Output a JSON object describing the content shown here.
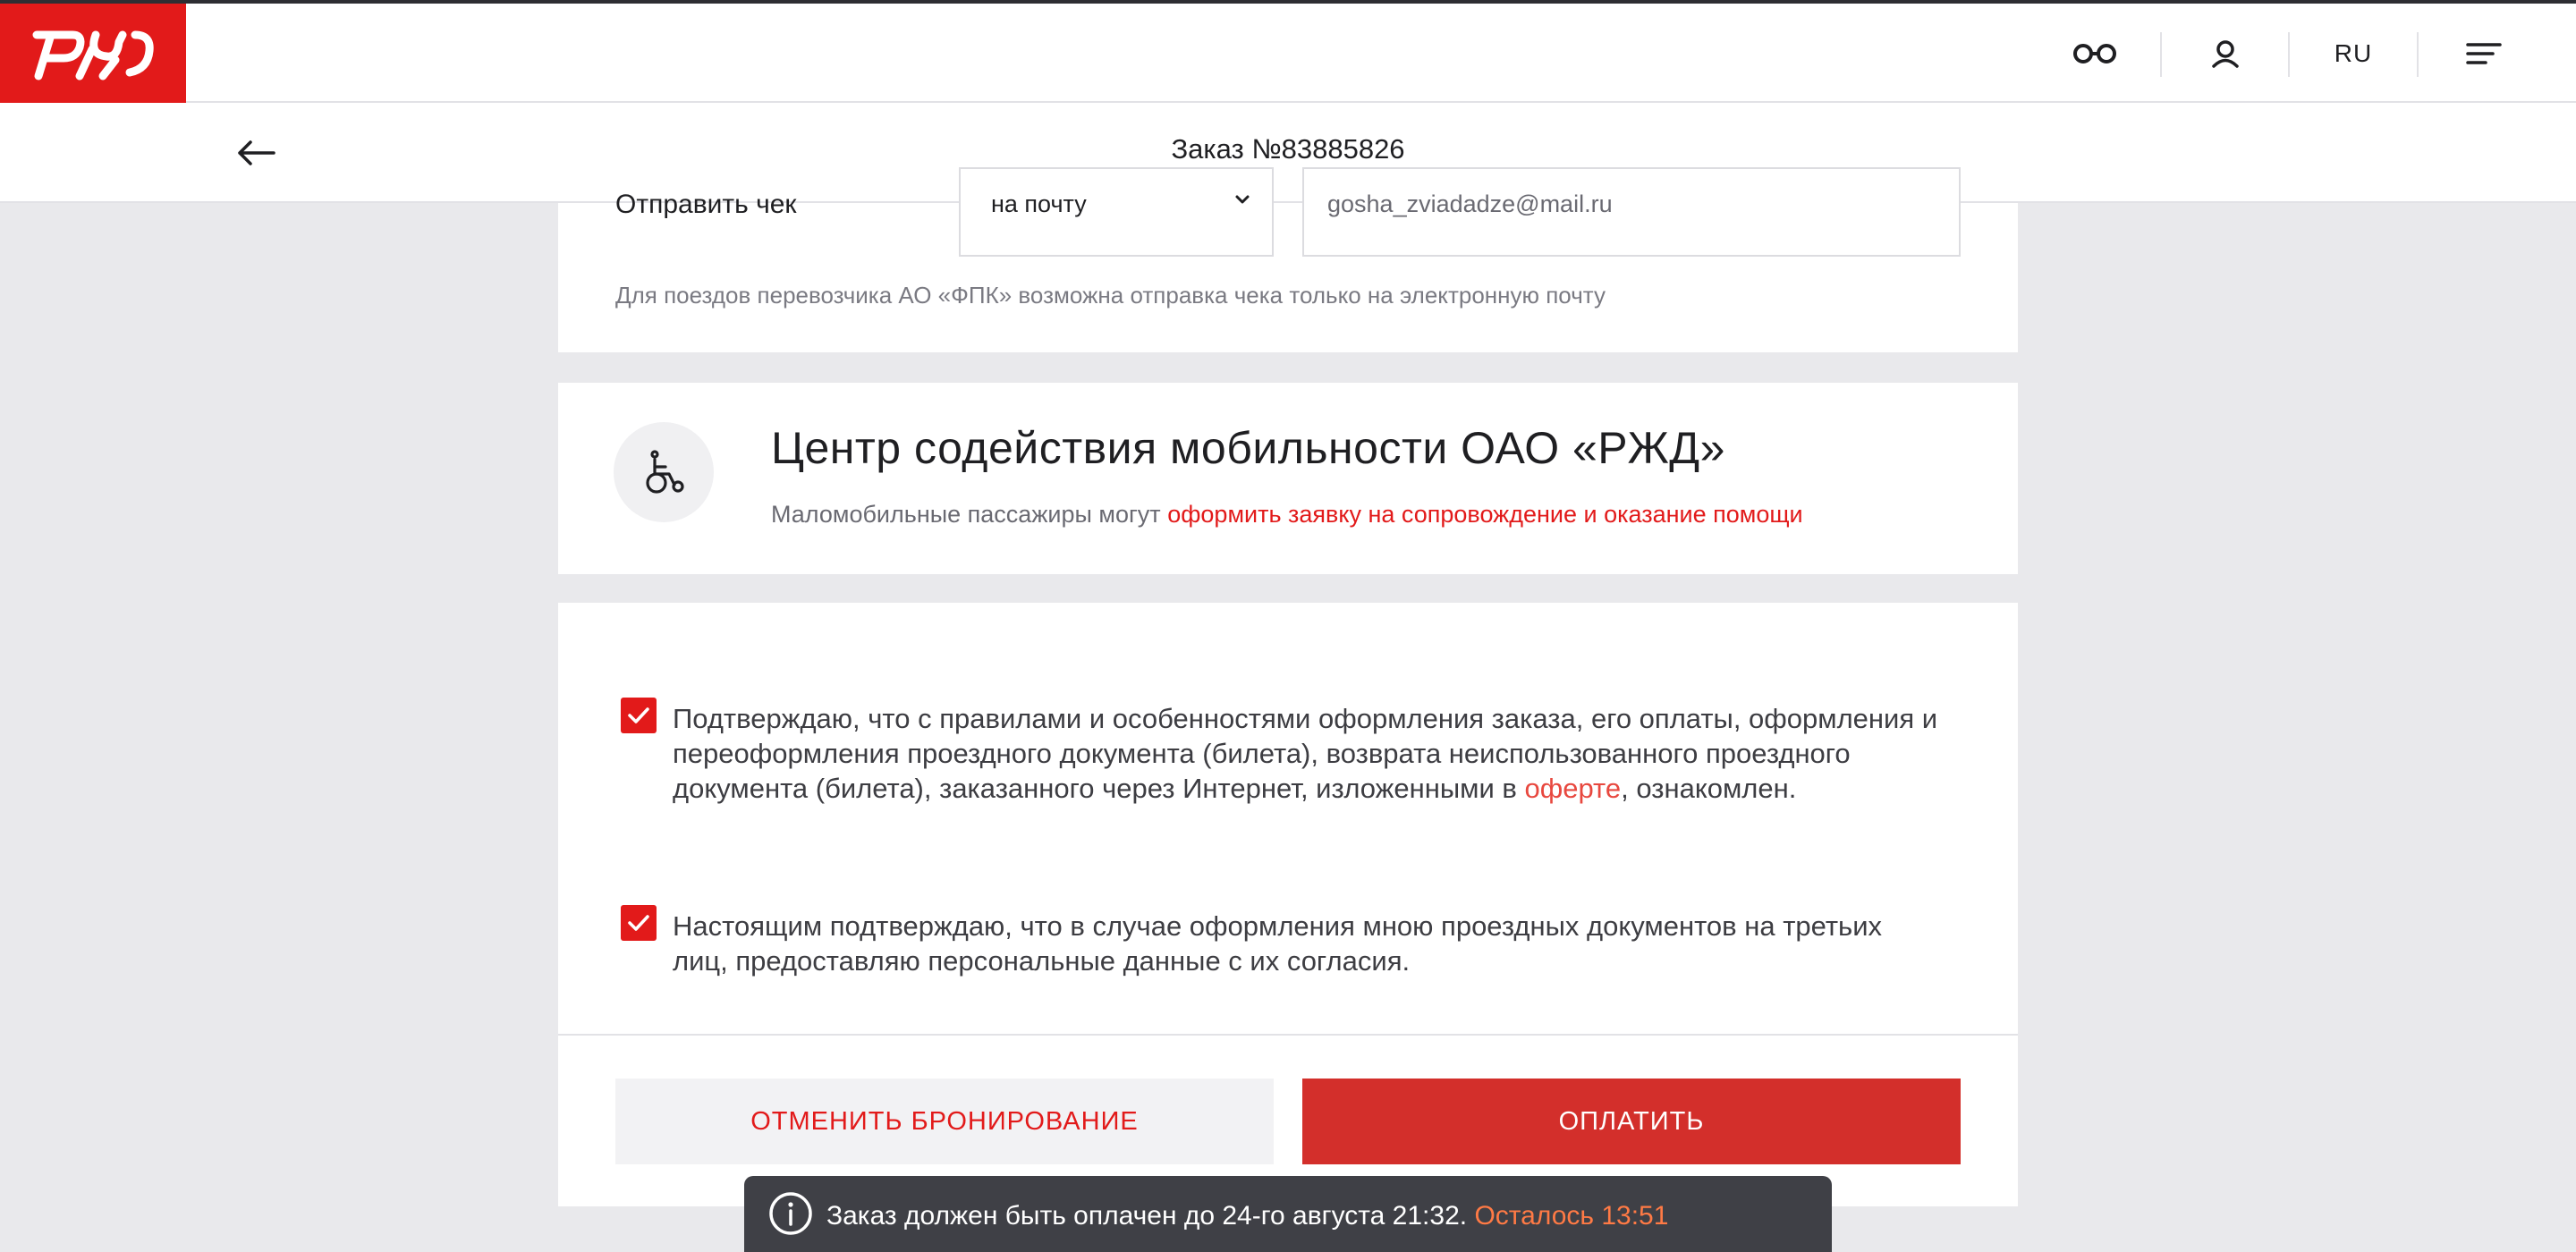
{
  "header": {
    "logo_alt": "РЖД",
    "lang": "RU",
    "icons": [
      "glasses-icon",
      "user-icon",
      "menu-icon"
    ]
  },
  "subheader": {
    "title": "Заказ №83885826"
  },
  "receipt": {
    "label": "Отправить чек",
    "method": "на почту",
    "email": "gosha_zviadadze@mail.ru",
    "note": "Для поездов перевозчика АО «ФПК» возможна отправка чека только на электронную почту"
  },
  "mobility": {
    "title": "Центр содействия мобильности ОАО «РЖД»",
    "text": "Маломобильные пассажиры могут ",
    "link": "оформить заявку на сопровождение и оказание помощи"
  },
  "agreements": {
    "first_before": "Подтверждаю, что с правилами и особенностями оформления заказа, его оплаты, оформления и переоформления проездного документа (билета), возврата неиспользованного проездного документа (билета), заказанного через Интернет, изложенными в ",
    "first_link": "оферте",
    "first_after": ", ознакомлен.",
    "second": "Настоящим подтверждаю, что в случае оформления мною проездных документов на третьих лиц, предоставляю персональные данные с их согласия.",
    "first_checked": true,
    "second_checked": true
  },
  "actions": {
    "cancel": "ОТМЕНИТЬ БРОНИРОВАНИЕ",
    "pay": "ОПЛАТИТЬ"
  },
  "toast": {
    "text": "Заказ должен быть оплачен до 24-го августа 21:32. ",
    "remaining": "Осталось 13:51"
  },
  "colors": {
    "brand_red": "#e21a1a",
    "pay_button": "#d32f2b",
    "toast_bg": "#3f4046",
    "toast_accent": "#ff7a45"
  }
}
